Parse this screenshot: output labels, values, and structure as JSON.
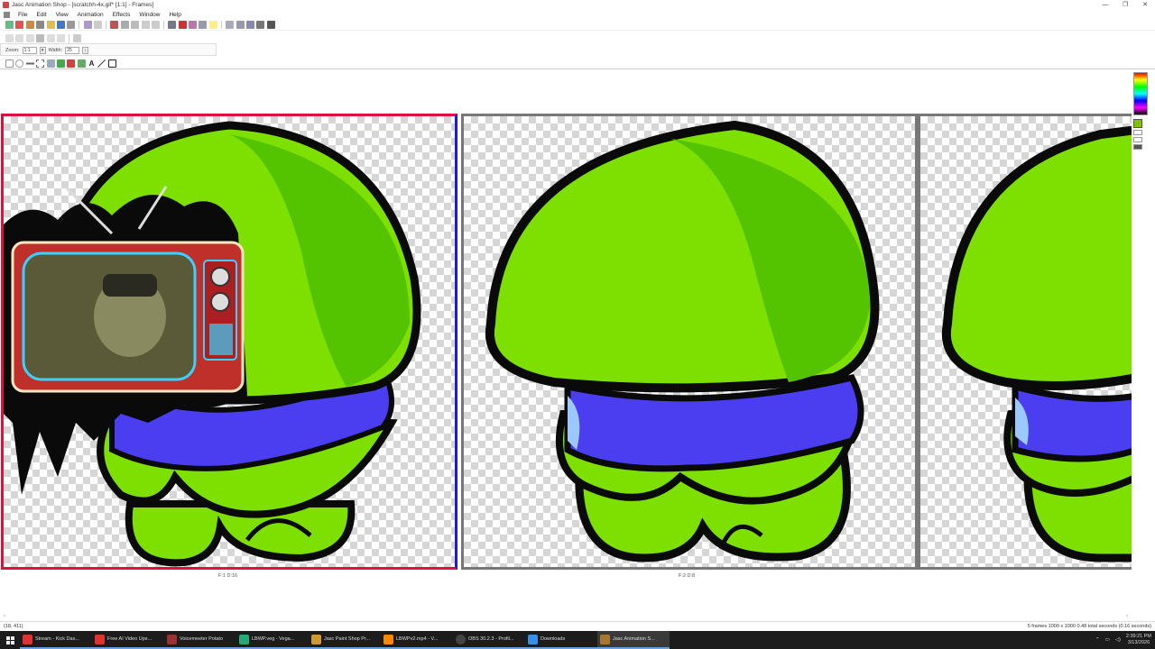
{
  "window": {
    "title": "Jasc Animation Shop - [scratchh-4x.gif* [1:1] - Frames]",
    "controls": [
      "—",
      "❐",
      "✕"
    ]
  },
  "menus": [
    "File",
    "Edit",
    "View",
    "Animation",
    "Effects",
    "Window",
    "Help"
  ],
  "tool_options": {
    "zoom_label": "Zoom:",
    "zoom_value": "1:1",
    "width_label": "Width:",
    "width_value": "25"
  },
  "frames": [
    {
      "label": "F:1  D:16",
      "selected": true
    },
    {
      "label": "F:2  D:8",
      "selected": false
    },
    {
      "label": "",
      "selected": false
    }
  ],
  "status": {
    "coords": "(18, 411)",
    "info": "5 frames  1000 x 1000  0.48 total seconds  (0.16 seconds)"
  },
  "taskbar": {
    "items": [
      {
        "label": "Stream - Kick Das...",
        "icon_color": "#d33"
      },
      {
        "label": "Free AI Video Ups...",
        "icon_color": "#d33"
      },
      {
        "label": "Voicemeeter Potato",
        "icon_color": "#933"
      },
      {
        "label": "LBWP.veg - Vega...",
        "icon_color": "#2a7"
      },
      {
        "label": "Jasc Paint Shop Pr...",
        "icon_color": "#c93"
      },
      {
        "label": "LBWPv2.mp4 - V...",
        "icon_color": "#f80"
      },
      {
        "label": "OBS 30.2.3 - Profil...",
        "icon_color": "#444"
      },
      {
        "label": "Downloads",
        "icon_color": "#3a8ee6"
      },
      {
        "label": "Jasc Animation S...",
        "icon_color": "#a73"
      }
    ],
    "clock_time": "2:39:21 PM",
    "clock_date": "3/13/2026"
  },
  "colors": {
    "body_green": "#7ee000",
    "shade_green": "#55c400",
    "shirt_blue": "#4a3ef0",
    "outline": "#0a0a0a"
  }
}
